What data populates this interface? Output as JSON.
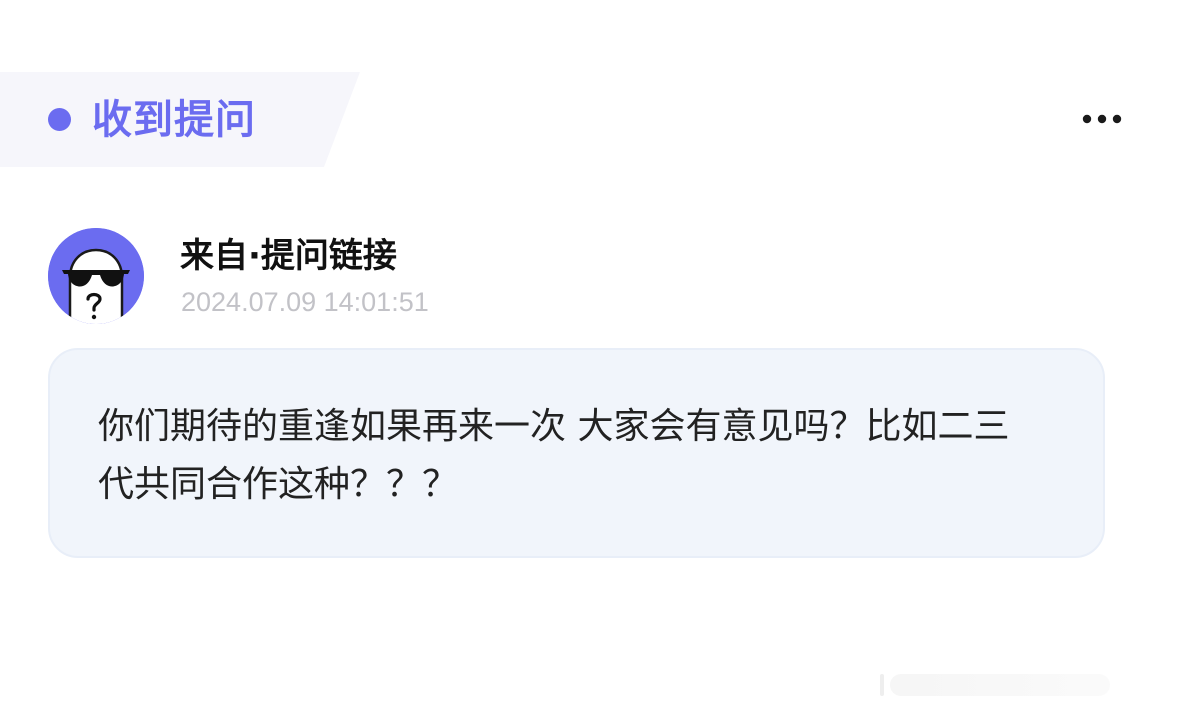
{
  "header": {
    "title": "收到提问",
    "accent_color": "#6b6cf0",
    "more_icon": "ellipsis-horizontal-icon"
  },
  "sender": {
    "name": "来自·提问链接",
    "time": "2024.07.09 14:01:51",
    "avatar_icon": "sunglasses-ghost-avatar-icon"
  },
  "question": {
    "text": "你们期待的重逢如果再来一次 大家会有意见吗？比如二三代共同合作这种？？？"
  }
}
